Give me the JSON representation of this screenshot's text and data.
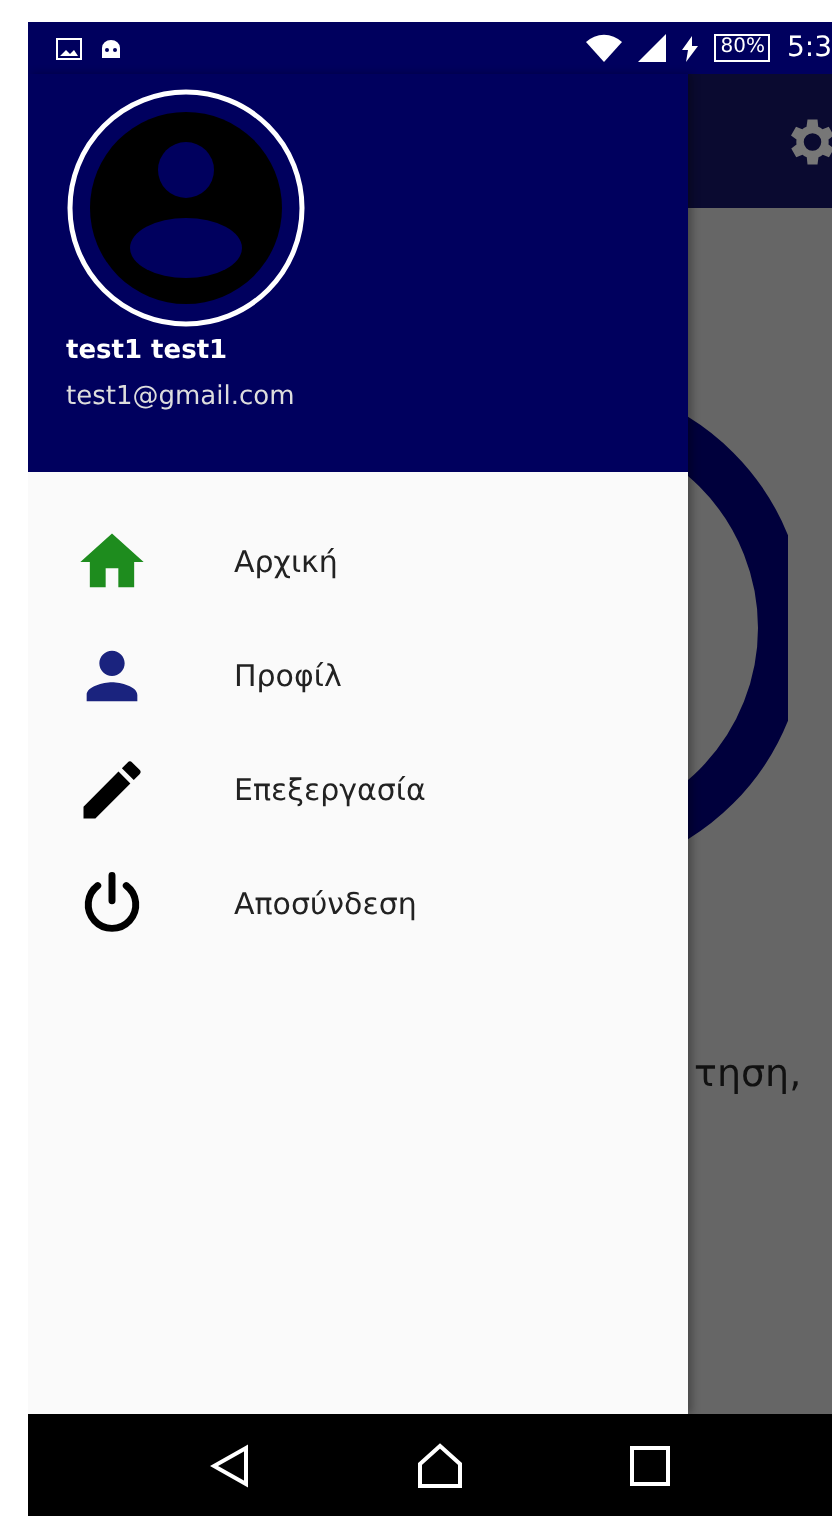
{
  "status_bar": {
    "battery": "80%",
    "time": "5:3"
  },
  "drawer": {
    "user_name": "test1 test1",
    "email": "test1@gmail.com",
    "items": [
      {
        "kind": "home",
        "label": "Αρχική",
        "color": "#1e8c1e"
      },
      {
        "kind": "profile",
        "label": "Προφίλ",
        "color": "#1a237e"
      },
      {
        "kind": "edit",
        "label": "Επεξεργασία",
        "color": "#000000"
      },
      {
        "kind": "logout",
        "label": "Αποσύνδεση",
        "color": "#000000"
      }
    ]
  },
  "background": {
    "text": "τηση,"
  }
}
